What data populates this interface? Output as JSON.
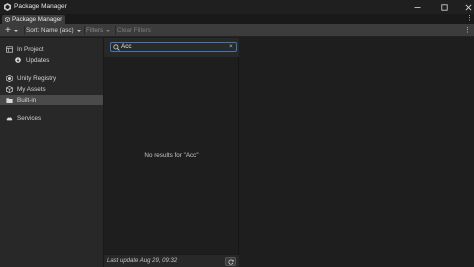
{
  "window": {
    "title": "Package Manager",
    "tab_label": "Package Manager",
    "controls": [
      "minimize-icon",
      "maximize-icon",
      "close-icon"
    ]
  },
  "toolbar": {
    "add_label": "+",
    "sort_label": "Sort: Name (asc)",
    "filters_label": "Filters",
    "clear_filters_label": "Clear Filters",
    "more_label": "⋮"
  },
  "sidebar": {
    "items": [
      {
        "label": "In Project",
        "icon": "project-folder-icon"
      },
      {
        "label": "Updates",
        "icon": "update-badge-icon"
      },
      {
        "label": "Unity Registry",
        "icon": "unity-logo-icon"
      },
      {
        "label": "My Assets",
        "icon": "asset-box-icon"
      },
      {
        "label": "Built-in",
        "icon": "built-in-folder-icon",
        "selected": true
      },
      {
        "label": "Services",
        "icon": "cloud-icon"
      }
    ]
  },
  "search": {
    "value": "Acc",
    "clear_label": "×"
  },
  "list": {
    "empty_message": "No results for \"Acc\""
  },
  "status": {
    "last_update": "Last update Aug 29, 09:32"
  },
  "colors": {
    "accent_focus": "#3a79bb",
    "selected_bg": "#4a4a4a",
    "update_badge": "#e0e0e0"
  }
}
